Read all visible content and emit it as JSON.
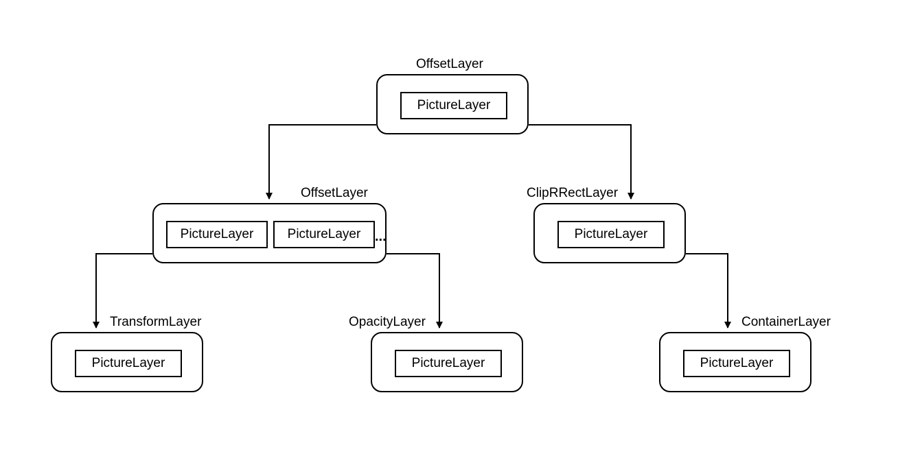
{
  "nodes": {
    "root": {
      "title": "OffsetLayer",
      "inners": [
        "PictureLayer"
      ]
    },
    "l2a": {
      "title": "OffsetLayer",
      "inners": [
        "PictureLayer",
        "PictureLayer"
      ],
      "ellipsis": "..."
    },
    "l2b": {
      "title": "ClipRRectLayer",
      "inners": [
        "PictureLayer"
      ]
    },
    "l3a": {
      "title": "TransformLayer",
      "inners": [
        "PictureLayer"
      ]
    },
    "l3b": {
      "title": "OpacityLayer",
      "inners": [
        "PictureLayer"
      ]
    },
    "l3c": {
      "title": "ContainerLayer",
      "inners": [
        "PictureLayer"
      ]
    }
  }
}
